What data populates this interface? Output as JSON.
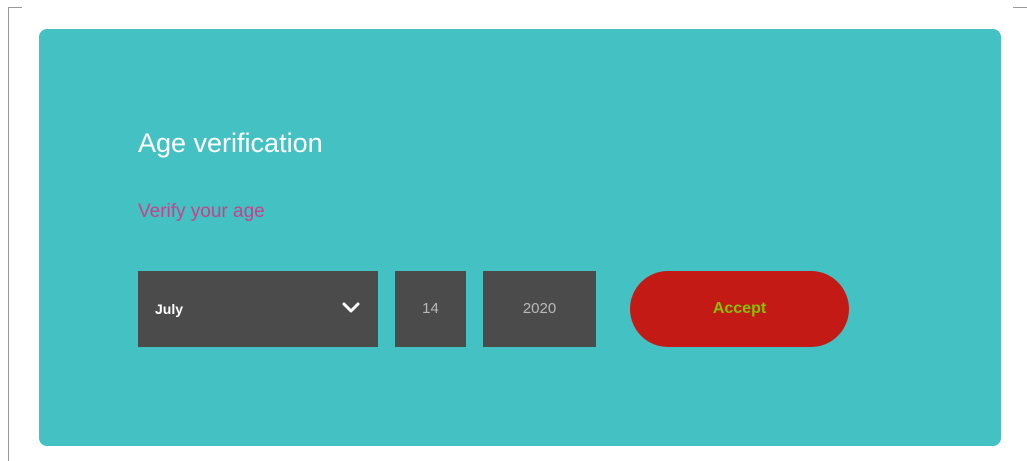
{
  "dialog": {
    "title": "Age verification",
    "subtitle": "Verify your age",
    "month": {
      "selected": "July",
      "icon": "chevron-down-icon"
    },
    "day": "14",
    "year": "2020",
    "accept_label": "Accept"
  },
  "colors": {
    "panel_background": "#43c1c3",
    "title_text": "#ffffff",
    "subtitle_text": "#cc3f8c",
    "field_background": "#4b4b4b",
    "field_text": "#b9b9b9",
    "button_background": "#c41a16",
    "button_text": "#83c400"
  }
}
